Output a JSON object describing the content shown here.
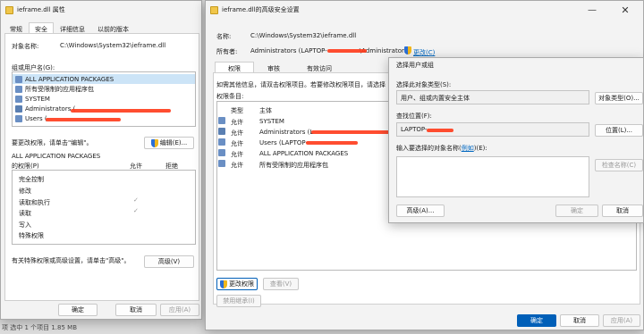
{
  "props_dialog": {
    "title": "ieframe.dll 属性",
    "tabs": [
      "常规",
      "安全",
      "详细信息",
      "以前的版本"
    ],
    "object_label": "对象名称:",
    "object_value": "C:\\Windows\\System32\\ieframe.dll",
    "groups_label": "组或用户名(G):",
    "groups": [
      "ALL APPLICATION PACKAGES",
      "所有受限制的应用程序包",
      "SYSTEM",
      "Administrators (",
      "Users ("
    ],
    "change_hint": "要更改权限，请单击\"编辑\"。",
    "edit_button": "编辑(E)...",
    "perm_header": "ALL APPLICATION PACKAGES",
    "perm_header2": "的权限(P)",
    "allow": "允许",
    "deny": "拒绝",
    "perms": [
      "完全控制",
      "修改",
      "读取和执行",
      "读取",
      "写入",
      "特殊权限"
    ],
    "special_hint": "有关特殊权限或高级设置，请单击\"高级\"。",
    "advanced_button": "高级(V)",
    "ok": "确定",
    "cancel": "取消",
    "apply": "应用(A)",
    "status": "项  选中 1 个项目  1.85 MB"
  },
  "adv_dialog": {
    "title": "ieframe.dll的高级安全设置",
    "name_label": "名称:",
    "name_value": "C:\\Windows\\System32\\ieframe.dll",
    "owner_label": "所有者:",
    "owner_value": "Administrators (LAPTOP-",
    "owner_tail": "\\Administrators)",
    "change_link": "更改(C)",
    "tabs": [
      "权限",
      "审核",
      "有效访问"
    ],
    "info_text": "如需其他信息，请双击权限项目。若要修改权限项目，请选择",
    "entries_label": "权限条目:",
    "col_type": "类型",
    "col_principal": "主体",
    "entries": [
      {
        "type": "允许",
        "principal": "SYSTEM"
      },
      {
        "type": "允许",
        "principal": "Administrators (L"
      },
      {
        "type": "允许",
        "principal": "Users (LAPTOP-"
      },
      {
        "type": "允许",
        "principal": "ALL APPLICATION PACKAGES"
      },
      {
        "type": "允许",
        "principal": "所有受限制的应用程序包"
      }
    ],
    "change_perm_button": "更改权限",
    "view_button": "查看(V)",
    "disable_inherit_button": "禁用继承(I)",
    "ok": "确定",
    "cancel": "取消",
    "apply": "应用(A)"
  },
  "select_dialog": {
    "title": "选择用户或组",
    "obj_type_label": "选择此对象类型(S):",
    "obj_type_value": "用户、组或内置安全主体",
    "obj_type_button": "对象类型(O)...",
    "location_label": "查找位置(F):",
    "location_value": "LAPTOP-",
    "location_button": "位置(L)...",
    "names_label_pre": "输入要选择的对象名称(",
    "names_label_link": "例如",
    "names_label_post": ")(E):",
    "check_names_button": "检查名称(C)",
    "advanced_button": "高级(A)...",
    "ok": "确定",
    "cancel": "取消"
  }
}
